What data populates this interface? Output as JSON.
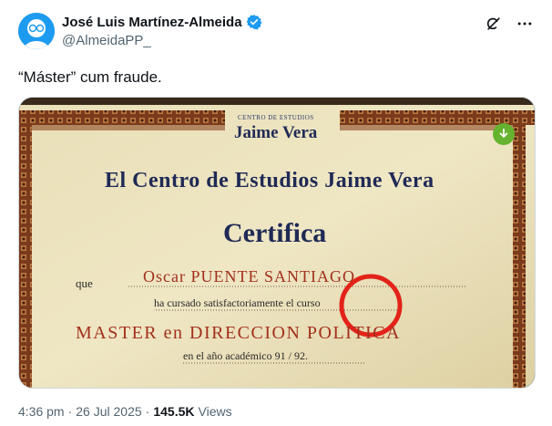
{
  "author": {
    "display_name": "José Luis Martínez-Almeida",
    "handle": "@AlmeidaPP_"
  },
  "tweet": {
    "text": "“Máster” cum fraude."
  },
  "certificate": {
    "center_small": "CENTRO DE ESTUDIOS",
    "center_name": "Jaime Vera",
    "heading": "El Centro de Estudios Jaime Vera",
    "certifies": "Certifica",
    "que": "que",
    "recipient": "Oscar PUENTE SANTIAGO",
    "course_line": "ha cursado satisfactoriamente el curso",
    "program": "MASTER en DIRECCION POLITICA",
    "year_line": "en el año académico 91 / 92."
  },
  "footer": {
    "time": "4:36 pm",
    "sep1": "·",
    "date": "26 Jul 2025",
    "sep2": "·",
    "views_count": "145.5K",
    "views_label": "Views"
  },
  "colors": {
    "verified_blue": "#1d9bf0",
    "highlight_red": "#e2231a",
    "download_green": "#65b32e"
  }
}
